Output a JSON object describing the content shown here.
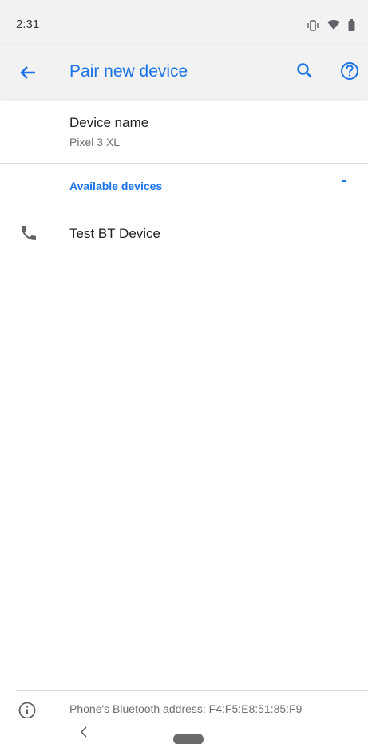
{
  "status_bar": {
    "time": "2:31",
    "icons": [
      "vibrate-icon",
      "wifi-icon",
      "battery-icon"
    ]
  },
  "app_bar": {
    "title": "Pair new device",
    "back_icon": "arrow-back-icon",
    "actions": [
      "search-icon",
      "help-icon"
    ],
    "accent_color": "#1a73e8"
  },
  "device_name": {
    "title": "Device name",
    "value": "Pixel 3 XL"
  },
  "available_devices": {
    "header": "Available devices",
    "scanning": true,
    "items": [
      {
        "icon": "phone-icon",
        "label": "Test BT Device"
      }
    ]
  },
  "footer": {
    "icon": "info-icon",
    "text": "Phone's Bluetooth address: F4:F5:E8:51:85:F9"
  },
  "nav_bar": {
    "buttons": [
      "nav-back-icon",
      "nav-home-pill"
    ]
  }
}
